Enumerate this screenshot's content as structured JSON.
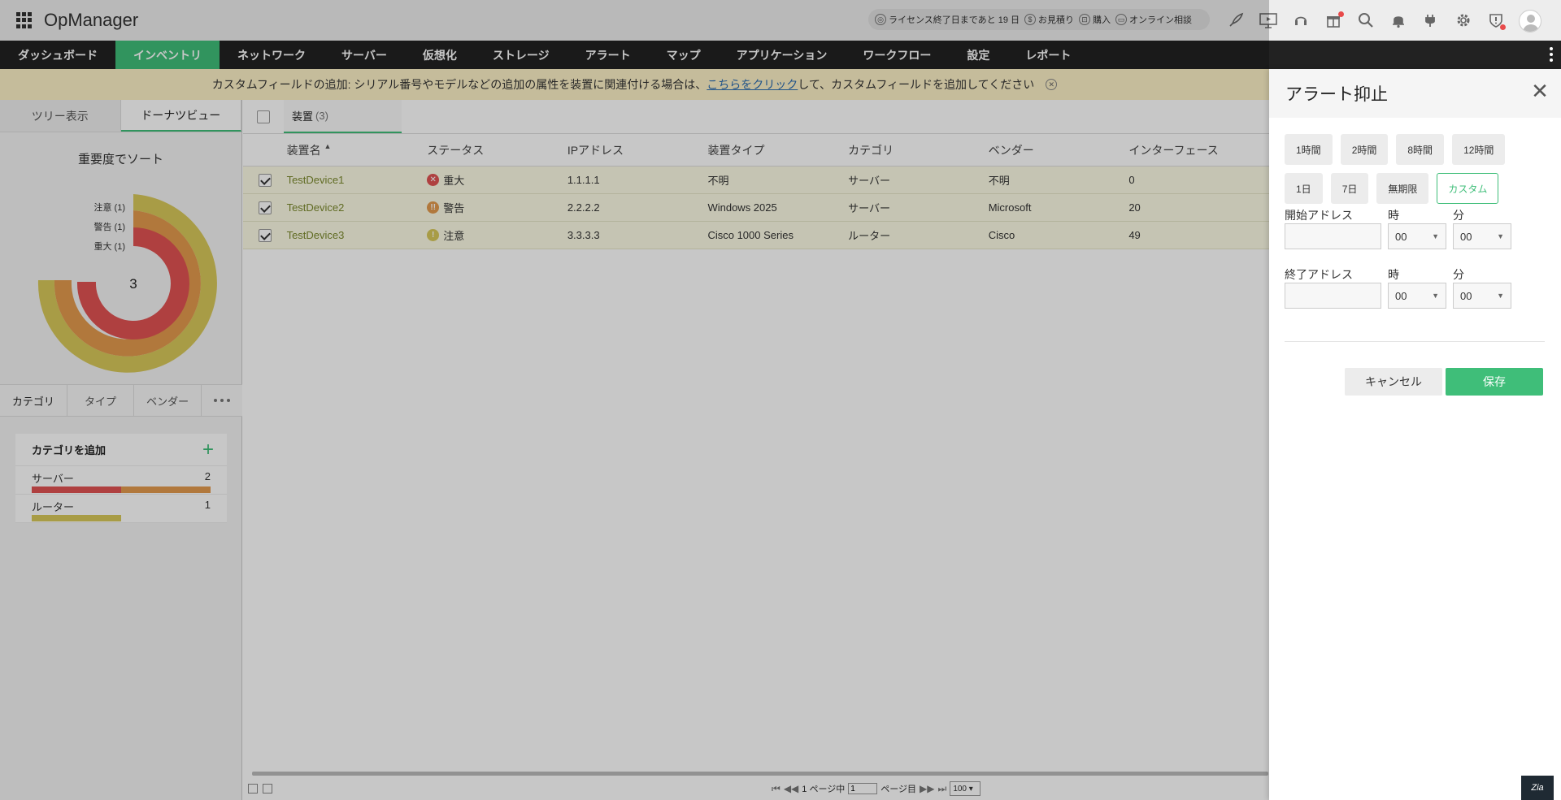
{
  "header": {
    "app_title": "OpManager",
    "license_text": "ライセンス終了日まであと 19 日",
    "quote_text": "お見積り",
    "purchase_text": "購入",
    "consult_text": "オンライン相談",
    "icons": [
      "rocket-icon",
      "presentation-icon",
      "headset-icon",
      "gift-icon",
      "search-icon",
      "bell-icon",
      "plug-icon",
      "gear-icon",
      "shield-alert-icon",
      "user-avatar"
    ]
  },
  "nav": {
    "items": [
      "ダッシュボード",
      "インベントリ",
      "ネットワーク",
      "サーバー",
      "仮想化",
      "ストレージ",
      "アラート",
      "マップ",
      "アプリケーション",
      "ワークフロー",
      "設定",
      "レポート"
    ],
    "active": "インベントリ"
  },
  "notice": {
    "prefix": "カスタムフィールドの追加: シリアル番号やモデルなどの追加の属性を装置に関連付ける場合は、",
    "link": "こちらをクリック",
    "suffix": "して、カスタムフィールドを追加してください"
  },
  "left_panel": {
    "tabs": [
      "ツリー表示",
      "ドーナツビュー"
    ],
    "active_tab": "ドーナツビュー",
    "donut_title": "重要度でソート",
    "donut_center": "3",
    "donut_legend": [
      {
        "label": "注意 (1)",
        "color": "#d8c85a"
      },
      {
        "label": "警告 (1)",
        "color": "#e39a4e"
      },
      {
        "label": "重大 (1)",
        "color": "#e05252"
      }
    ],
    "bottom_tabs": [
      "カテゴリ",
      "タイプ",
      "ベンダー"
    ],
    "category_box": {
      "title": "カテゴリを追加",
      "rows": [
        {
          "name": "サーバー",
          "count": "2",
          "segments": [
            {
              "color": "#e05252",
              "fraction": 0.5
            },
            {
              "color": "#e39a4e",
              "fraction": 0.5
            }
          ]
        },
        {
          "name": "ルーター",
          "count": "1",
          "segments": [
            {
              "color": "#d8c85a",
              "fraction": 0.5
            }
          ]
        }
      ]
    }
  },
  "main": {
    "device_tab": "装置",
    "device_count": "(3)",
    "columns": [
      "装置名",
      "ステータス",
      "IPアドレス",
      "装置タイプ",
      "カテゴリ",
      "ベンダー",
      "インターフェース"
    ],
    "rows": [
      {
        "name": "TestDevice1",
        "status": "重大",
        "status_color": "#e05252",
        "status_glyph": "✕",
        "ip": "1.1.1.1",
        "type": "不明",
        "category": "サーバー",
        "vendor": "不明",
        "interfaces": "0",
        "checked": true
      },
      {
        "name": "TestDevice2",
        "status": "警告",
        "status_color": "#e39a4e",
        "status_glyph": "!!",
        "ip": "2.2.2.2",
        "type": "Windows 2025",
        "category": "サーバー",
        "vendor": "Microsoft",
        "interfaces": "20",
        "checked": true
      },
      {
        "name": "TestDevice3",
        "status": "注意",
        "status_color": "#d8c85a",
        "status_glyph": "!",
        "ip": "3.3.3.3",
        "type": "Cisco 1000 Series",
        "category": "ルーター",
        "vendor": "Cisco",
        "interfaces": "49",
        "checked": true
      }
    ]
  },
  "pager": {
    "page_of": "1 ページ中",
    "page_value": "1",
    "page_label": "ページ目",
    "per_page": "100"
  },
  "drawer": {
    "title": "アラート抑止",
    "presets": [
      "1時間",
      "2時間",
      "8時間",
      "12時間",
      "1日",
      "7日",
      "無期限",
      "カスタム"
    ],
    "active_preset": "カスタム",
    "start_label": "開始アドレス",
    "end_label": "終了アドレス",
    "hour_label": "時",
    "minute_label": "分",
    "start_hour": "00",
    "start_minute": "00",
    "end_hour": "00",
    "end_minute": "00",
    "cancel": "キャンセル",
    "save": "保存"
  },
  "zia_label": "Zia",
  "colors": {
    "accent": "#3fbe79",
    "critical": "#e05252",
    "warning": "#e39a4e",
    "attention": "#d8c85a"
  }
}
